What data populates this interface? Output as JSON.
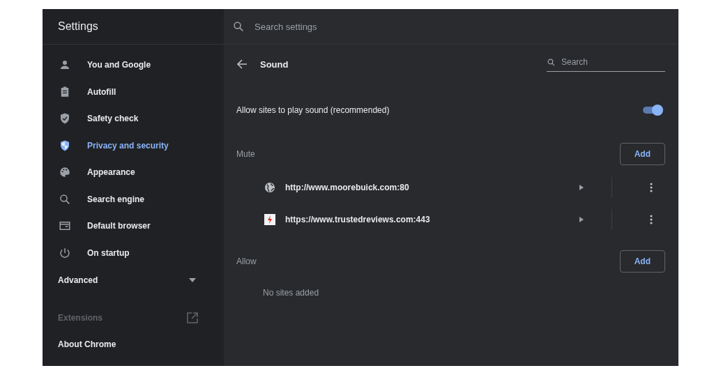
{
  "window": {
    "title": "Settings"
  },
  "search": {
    "placeholder": "Search settings"
  },
  "sidebar": {
    "items": [
      {
        "label": "You and Google",
        "selected": false
      },
      {
        "label": "Autofill",
        "selected": false
      },
      {
        "label": "Safety check",
        "selected": false
      },
      {
        "label": "Privacy and security",
        "selected": true
      },
      {
        "label": "Appearance",
        "selected": false
      },
      {
        "label": "Search engine",
        "selected": false
      },
      {
        "label": "Default browser",
        "selected": false
      },
      {
        "label": "On startup",
        "selected": false
      }
    ],
    "advanced": {
      "label": "Advanced",
      "expanded": false
    },
    "extensions": {
      "label": "Extensions"
    },
    "about": {
      "label": "About Chrome"
    }
  },
  "page": {
    "title": "Sound",
    "search_placeholder": "Search",
    "setting": {
      "label": "Allow sites to play sound (recommended)",
      "on": true
    },
    "sections": [
      {
        "title": "Mute",
        "button": "Add",
        "sites": [
          {
            "url": "http://www.moorebuick.com:80",
            "kind": "globe"
          },
          {
            "url": "https://www.trustedreviews.com:443",
            "kind": "favicon"
          }
        ]
      },
      {
        "title": "Allow",
        "button": "Add",
        "empty": "No sites added"
      }
    ]
  }
}
